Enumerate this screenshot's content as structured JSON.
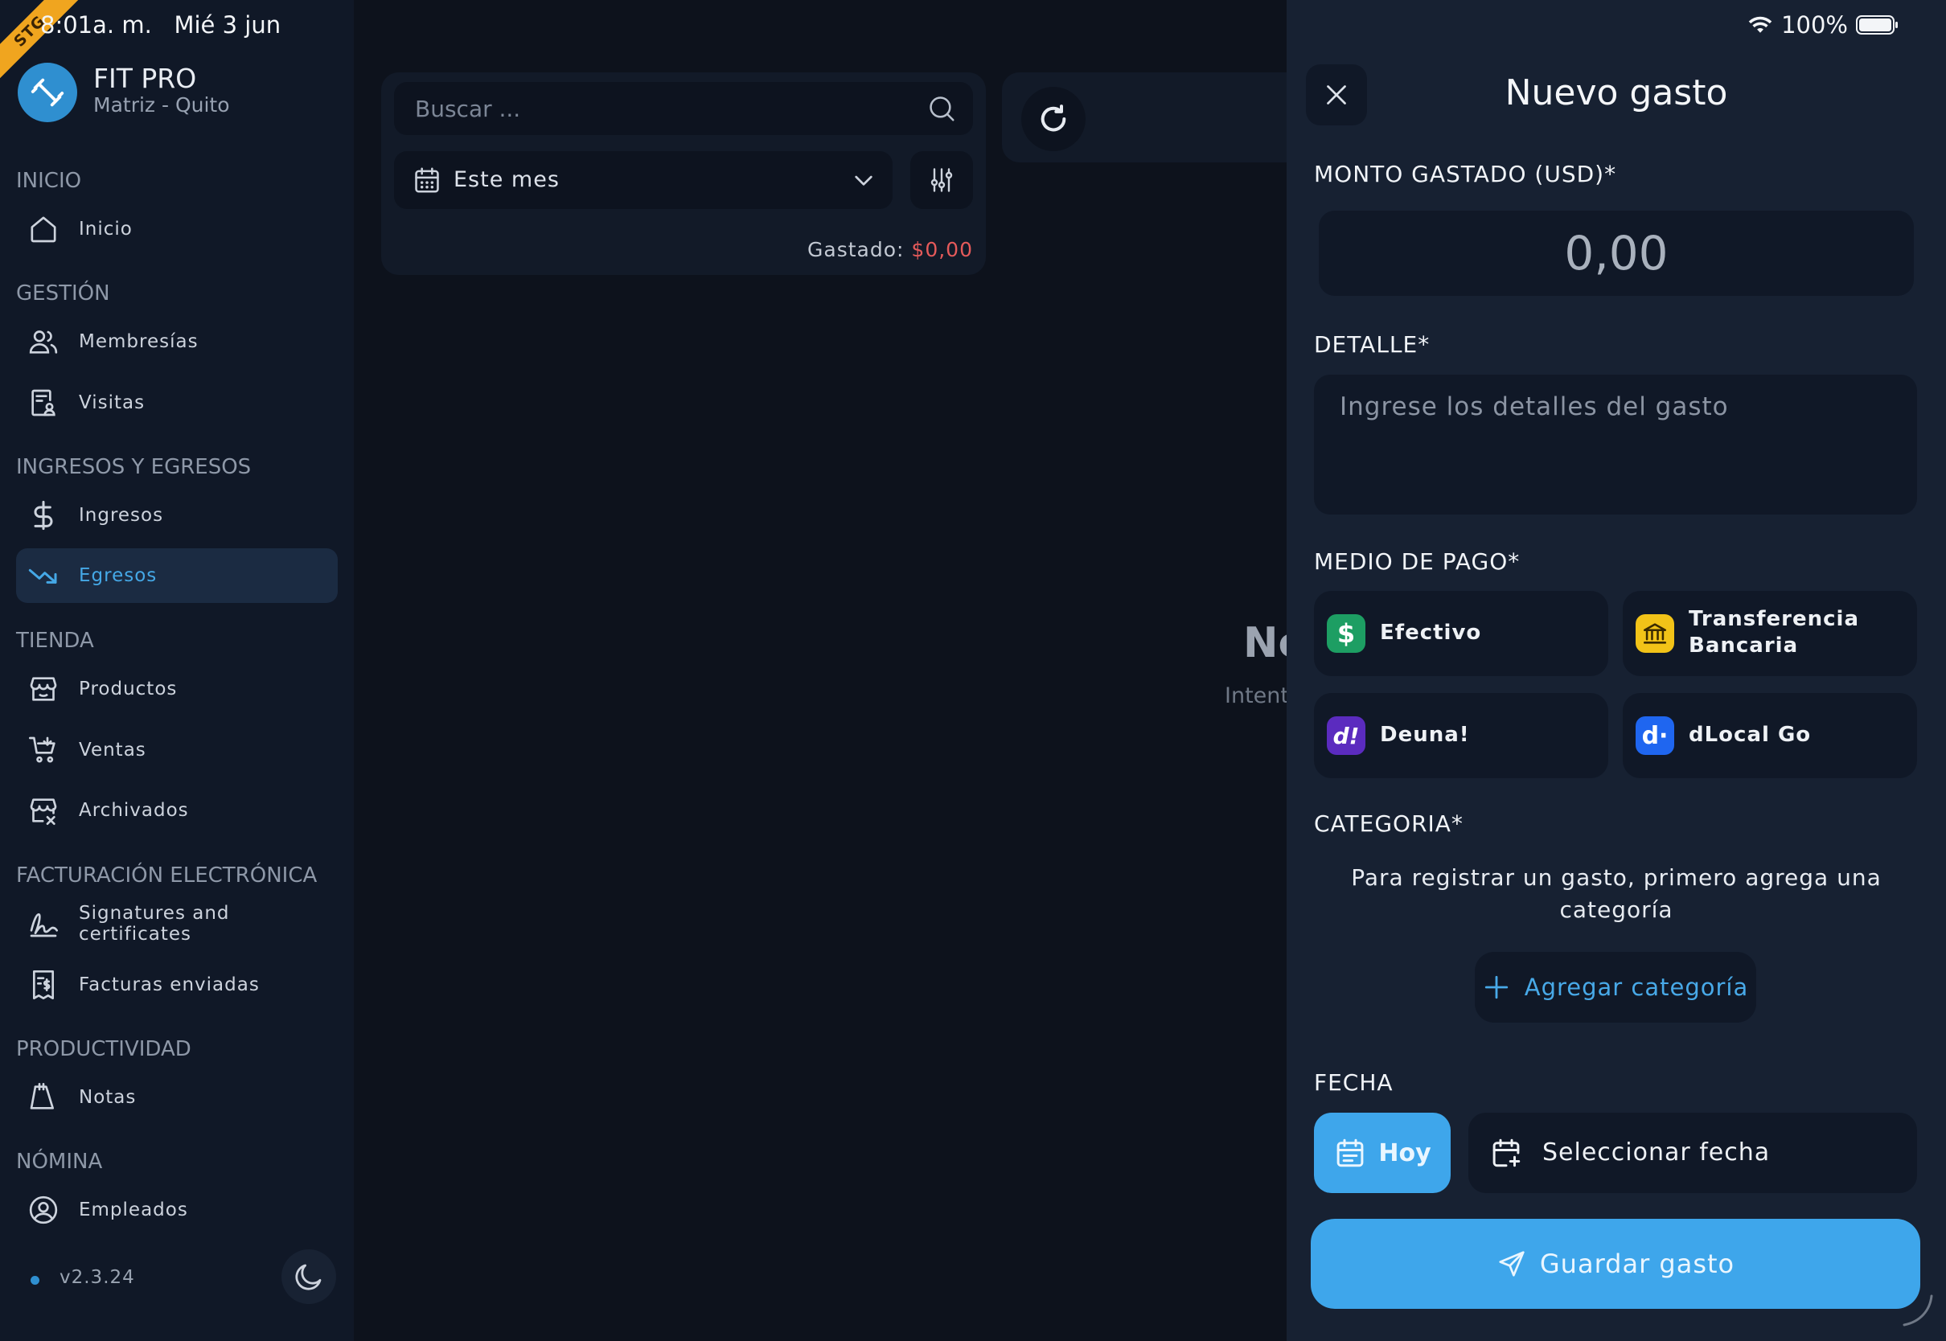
{
  "status_bar": {
    "time": "8:01a. m.   Mié 3 jun",
    "battery": "100%",
    "ribbon": "STG"
  },
  "brand": {
    "name": "FIT PRO",
    "branch": "Matriz - Quito"
  },
  "sidebar": {
    "sections": [
      {
        "title": "INICIO",
        "items": [
          {
            "label": "Inicio",
            "icon": "home-icon"
          }
        ]
      },
      {
        "title": "GESTIÓN",
        "items": [
          {
            "label": "Membresías",
            "icon": "users-icon"
          },
          {
            "label": "Visitas",
            "icon": "visitor-badge-icon"
          }
        ]
      },
      {
        "title": "INGRESOS Y EGRESOS",
        "items": [
          {
            "label": "Ingresos",
            "icon": "dollar-icon"
          },
          {
            "label": "Egresos",
            "icon": "trending-down-icon",
            "active": true
          }
        ]
      },
      {
        "title": "TIENDA",
        "items": [
          {
            "label": "Productos",
            "icon": "store-icon"
          },
          {
            "label": "Ventas",
            "icon": "cart-icon"
          },
          {
            "label": "Archivados",
            "icon": "store-archive-icon"
          }
        ]
      },
      {
        "title": "FACTURACIÓN ELECTRÓNICA",
        "items": [
          {
            "label": "Signatures and certificates",
            "icon": "signature-icon"
          },
          {
            "label": "Facturas enviadas",
            "icon": "invoice-icon"
          }
        ]
      },
      {
        "title": "PRODUCTIVIDAD",
        "items": [
          {
            "label": "Notas",
            "icon": "notes-icon"
          }
        ]
      },
      {
        "title": "NÓMINA",
        "items": [
          {
            "label": "Empleados",
            "icon": "user-circle-icon"
          }
        ]
      }
    ],
    "version": "v2.3.24"
  },
  "main": {
    "search_placeholder": "Buscar ...",
    "date_filter": "Este mes",
    "spent_label": "Gastado:",
    "spent_value": "$0,00",
    "empty_title": "Nc",
    "empty_sub": "Intent"
  },
  "panel": {
    "title": "Nuevo gasto",
    "amount_label": "MONTO GASTADO (USD)*",
    "amount_placeholder": "0,00",
    "detail_label": "DETALLE*",
    "detail_placeholder": "Ingrese los detalles del gasto",
    "payment_label": "MEDIO DE PAGO*",
    "payment_methods": [
      {
        "label": "Efectivo",
        "badge": "$",
        "color": "#1d9e63"
      },
      {
        "label": "Transferencia Bancaria",
        "badge": "bank",
        "color": "#f2c318"
      },
      {
        "label": "Deuna!",
        "badge": "d!",
        "color": "#5b2bbf"
      },
      {
        "label": "dLocal Go",
        "badge": "d·",
        "color": "#1f66f0"
      }
    ],
    "category_label": "CATEGORIA*",
    "category_message": "Para registrar un gasto, primero agrega una categoría",
    "add_category": "Agregar categoría",
    "date_label": "FECHA",
    "today_button": "Hoy",
    "select_date": "Seleccionar fecha",
    "save_button": "Guardar gasto"
  },
  "colors": {
    "accent": "#3ea6eb",
    "danger": "#e55a5a",
    "panel_bg": "#172132",
    "sidebar_bg": "#101827"
  }
}
